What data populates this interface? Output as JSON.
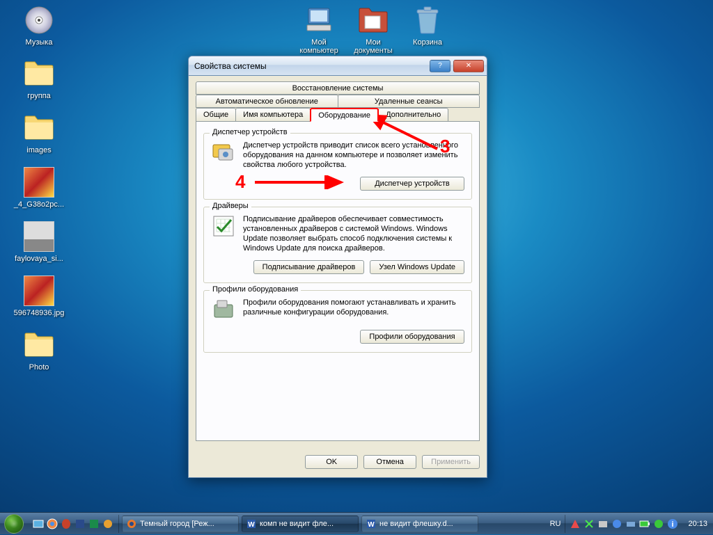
{
  "desktop": {
    "icons": [
      {
        "label": "Музыка",
        "name": "desktop-icon-music",
        "type": "cd"
      },
      {
        "label": "группа",
        "name": "desktop-icon-group",
        "type": "folder"
      },
      {
        "label": "images",
        "name": "desktop-icon-images",
        "type": "folder"
      },
      {
        "label": "_4_G38o2pc...",
        "name": "desktop-icon-file1",
        "type": "thumb"
      },
      {
        "label": "faylovaya_si...",
        "name": "desktop-icon-file2",
        "type": "thumb2"
      },
      {
        "label": "596748936.jpg",
        "name": "desktop-icon-file3",
        "type": "thumb"
      },
      {
        "label": "Photo",
        "name": "desktop-icon-photo",
        "type": "folder"
      }
    ],
    "top_icons": [
      {
        "label": "Мой компьютер",
        "name": "desktop-icon-mycomputer"
      },
      {
        "label": "Мои документы",
        "name": "desktop-icon-mydocs"
      },
      {
        "label": "Корзина",
        "name": "desktop-icon-recyclebin"
      }
    ]
  },
  "dialog": {
    "title": "Свойства системы",
    "tabs_row1": [
      "Восстановление системы"
    ],
    "tabs_row2": [
      "Автоматическое обновление",
      "Удаленные сеансы"
    ],
    "tabs_row3": [
      "Общие",
      "Имя компьютера",
      "Оборудование",
      "Дополнительно"
    ],
    "active_tab": "Оборудование",
    "group1": {
      "legend": "Диспетчер устройств",
      "text": "Диспетчер устройств приводит список всего установленного оборудования на данном компьютере и позволяет изменить свойства любого устройства.",
      "button": "Диспетчер устройств"
    },
    "group2": {
      "legend": "Драйверы",
      "text": "Подписывание драйверов обеспечивает совместимость установленных драйверов с системой Windows.  Windows Update позволяет выбрать способ подключения системы к Windows Update для поиска драйверов.",
      "button1": "Подписывание драйверов",
      "button2": "Узел Windows Update"
    },
    "group3": {
      "legend": "Профили оборудования",
      "text": "Профили оборудования помогают устанавливать и хранить различные конфигурации оборудования.",
      "button": "Профили оборудования"
    },
    "buttons": {
      "ok": "OK",
      "cancel": "Отмена",
      "apply": "Применить"
    }
  },
  "annotations": {
    "n3": "3",
    "n4": "4"
  },
  "taskbar": {
    "tasks": [
      {
        "label": "Темный город [Реж...",
        "icon": "firefox"
      },
      {
        "label": "комп не видит фле...",
        "icon": "word"
      },
      {
        "label": "не видит флешку.d...",
        "icon": "word"
      }
    ],
    "lang": "RU",
    "clock": "20:13"
  }
}
